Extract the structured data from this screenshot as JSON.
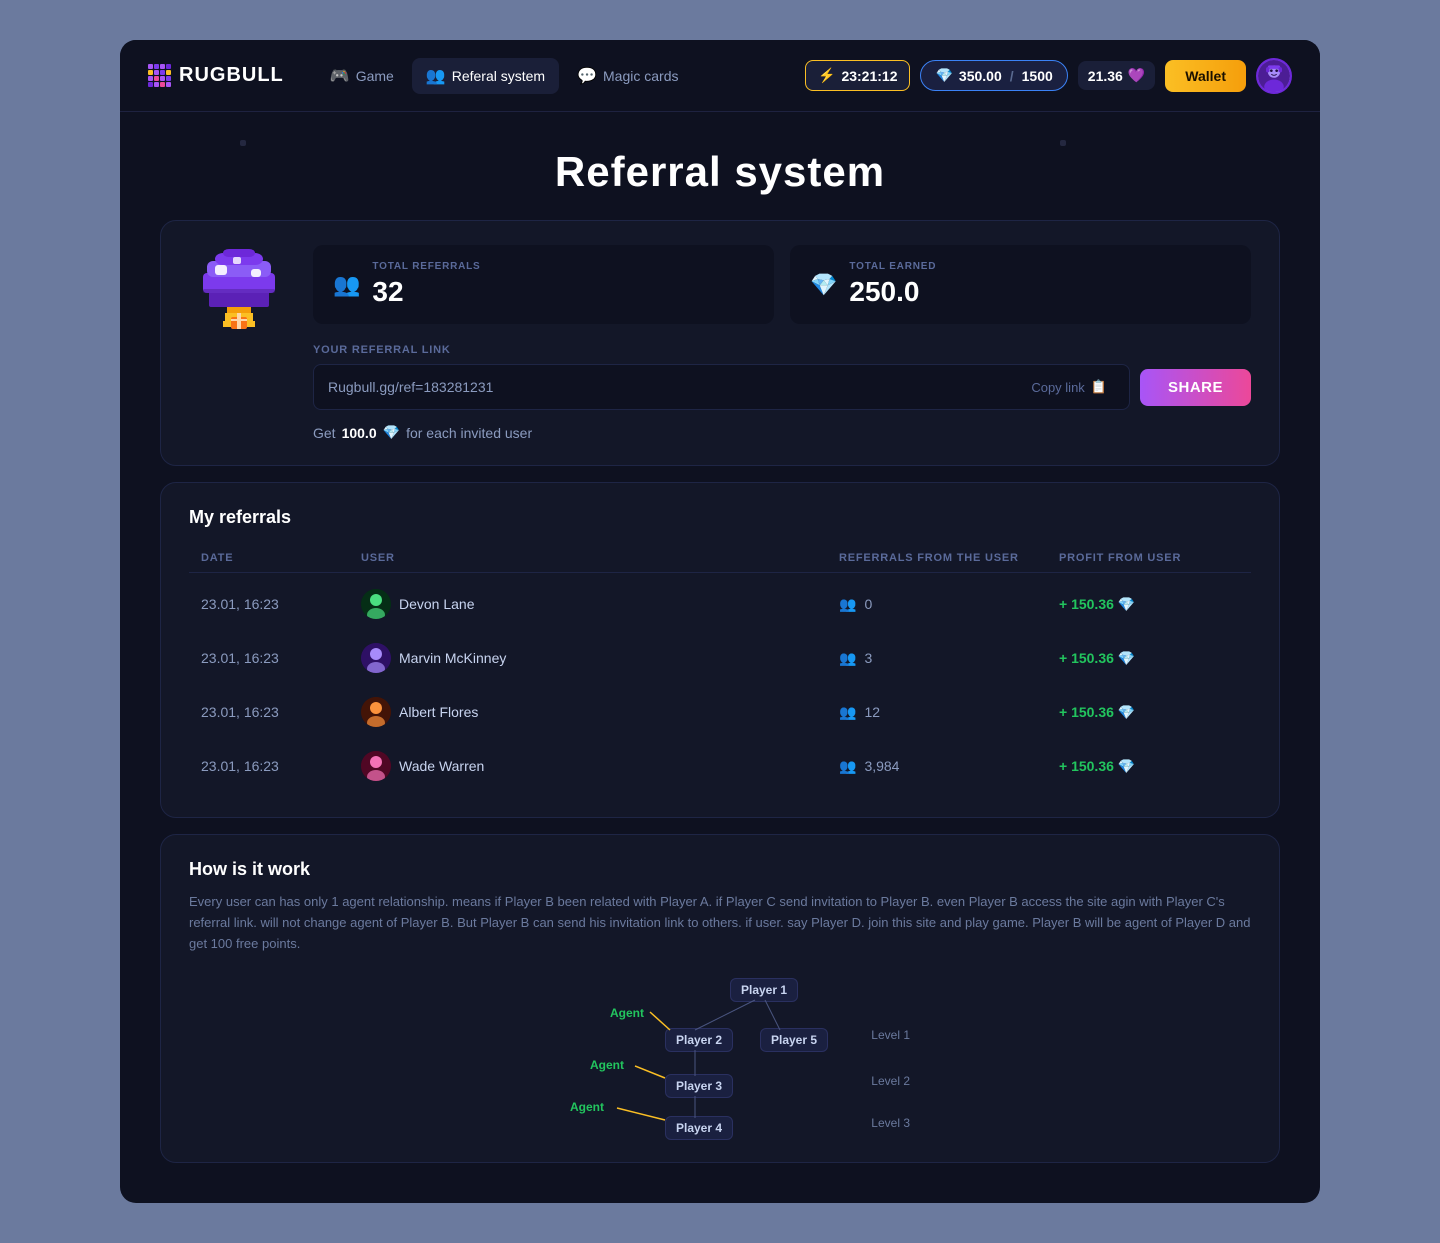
{
  "app": {
    "title": "RUGBULL",
    "logo_colors": [
      "#a855f7",
      "#7c3aed",
      "#6d28d9",
      "#fbbf24",
      "#f59e0b",
      "#ec4899",
      "#ef4444",
      "#fff"
    ]
  },
  "navbar": {
    "game_label": "Game",
    "referral_label": "Referal system",
    "magic_cards_label": "Magic cards",
    "timer_value": "23:21:12",
    "currency_value": "350.00",
    "currency_max": "1500",
    "gem_value": "21.36",
    "wallet_label": "Wallet"
  },
  "page": {
    "title": "Referral system"
  },
  "stats": {
    "total_referrals_label": "TOTAL REFERRALS",
    "total_referrals_value": "32",
    "total_earned_label": "TOTAL EaRNED",
    "total_earned_value": "250.0"
  },
  "referral_link": {
    "label": "YOUR REFERRAL LINK",
    "value": "Rugbull.gg/ref=183281231",
    "copy_label": "Copy link",
    "share_label": "SHARE",
    "earn_prefix": "Get",
    "earn_amount": "100.0",
    "earn_suffix": "for each invited user"
  },
  "my_referrals": {
    "section_title": "My referrals",
    "columns": {
      "date": "DATE",
      "user": "USER",
      "referrals_from_user": "REFERRALS FROM THE USER",
      "profit_from_user": "PROFIT FROM USER"
    },
    "rows": [
      {
        "date": "23.01, 16:23",
        "user": "Devon Lane",
        "avatar_color": "#4ade80",
        "avatar_bg": "#052e16",
        "referrals": "0",
        "profit": "+ 150.36"
      },
      {
        "date": "23.01, 16:23",
        "user": "Marvin McKinney",
        "avatar_color": "#a78bfa",
        "avatar_bg": "#2e1065",
        "referrals": "3",
        "profit": "+ 150.36"
      },
      {
        "date": "23.01, 16:23",
        "user": "Albert Flores",
        "avatar_color": "#fb923c",
        "avatar_bg": "#431407",
        "referrals": "12",
        "profit": "+ 150.36"
      },
      {
        "date": "23.01, 16:23",
        "user": "Wade Warren",
        "avatar_color": "#f472b6",
        "avatar_bg": "#500724",
        "referrals": "3,984",
        "profit": "+ 150.36"
      }
    ]
  },
  "how_it_works": {
    "title": "How is it work",
    "text": "Every user can has only 1 agent relationship. means if Player B been related with Player A. if Player C send invitation to Player B. even Player B access the site agin with Player C's referral link. will not change agent of Player B. But Player B can send his invitation link to others. if user. say Player D. join this site and play game. Player B will be agent of Player D and get 100 free points.",
    "diagram": {
      "player1": "Player 1",
      "player2": "Player 2",
      "player3": "Player 3",
      "player4": "Player 4",
      "player5": "Player 5",
      "agent_label": "Agent",
      "level1": "Level 1",
      "level2": "Level 2",
      "level3": "Level 3"
    }
  }
}
